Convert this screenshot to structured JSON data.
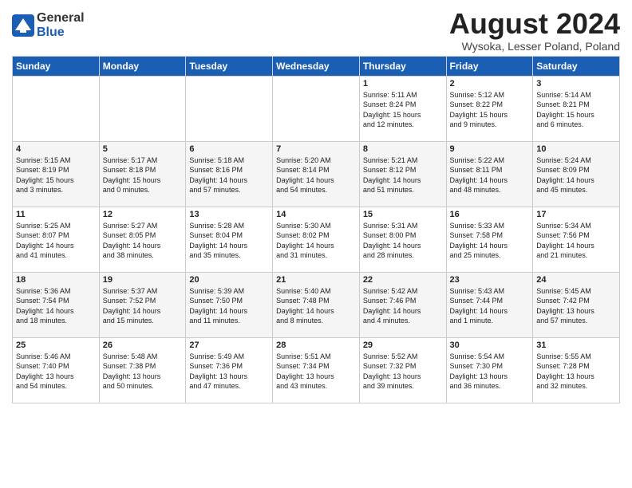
{
  "header": {
    "logo_general": "General",
    "logo_blue": "Blue",
    "title": "August 2024",
    "location": "Wysoka, Lesser Poland, Poland"
  },
  "days_of_week": [
    "Sunday",
    "Monday",
    "Tuesday",
    "Wednesday",
    "Thursday",
    "Friday",
    "Saturday"
  ],
  "weeks": [
    [
      {
        "day": "",
        "info": ""
      },
      {
        "day": "",
        "info": ""
      },
      {
        "day": "",
        "info": ""
      },
      {
        "day": "",
        "info": ""
      },
      {
        "day": "1",
        "info": "Sunrise: 5:11 AM\nSunset: 8:24 PM\nDaylight: 15 hours\nand 12 minutes."
      },
      {
        "day": "2",
        "info": "Sunrise: 5:12 AM\nSunset: 8:22 PM\nDaylight: 15 hours\nand 9 minutes."
      },
      {
        "day": "3",
        "info": "Sunrise: 5:14 AM\nSunset: 8:21 PM\nDaylight: 15 hours\nand 6 minutes."
      }
    ],
    [
      {
        "day": "4",
        "info": "Sunrise: 5:15 AM\nSunset: 8:19 PM\nDaylight: 15 hours\nand 3 minutes."
      },
      {
        "day": "5",
        "info": "Sunrise: 5:17 AM\nSunset: 8:18 PM\nDaylight: 15 hours\nand 0 minutes."
      },
      {
        "day": "6",
        "info": "Sunrise: 5:18 AM\nSunset: 8:16 PM\nDaylight: 14 hours\nand 57 minutes."
      },
      {
        "day": "7",
        "info": "Sunrise: 5:20 AM\nSunset: 8:14 PM\nDaylight: 14 hours\nand 54 minutes."
      },
      {
        "day": "8",
        "info": "Sunrise: 5:21 AM\nSunset: 8:12 PM\nDaylight: 14 hours\nand 51 minutes."
      },
      {
        "day": "9",
        "info": "Sunrise: 5:22 AM\nSunset: 8:11 PM\nDaylight: 14 hours\nand 48 minutes."
      },
      {
        "day": "10",
        "info": "Sunrise: 5:24 AM\nSunset: 8:09 PM\nDaylight: 14 hours\nand 45 minutes."
      }
    ],
    [
      {
        "day": "11",
        "info": "Sunrise: 5:25 AM\nSunset: 8:07 PM\nDaylight: 14 hours\nand 41 minutes."
      },
      {
        "day": "12",
        "info": "Sunrise: 5:27 AM\nSunset: 8:05 PM\nDaylight: 14 hours\nand 38 minutes."
      },
      {
        "day": "13",
        "info": "Sunrise: 5:28 AM\nSunset: 8:04 PM\nDaylight: 14 hours\nand 35 minutes."
      },
      {
        "day": "14",
        "info": "Sunrise: 5:30 AM\nSunset: 8:02 PM\nDaylight: 14 hours\nand 31 minutes."
      },
      {
        "day": "15",
        "info": "Sunrise: 5:31 AM\nSunset: 8:00 PM\nDaylight: 14 hours\nand 28 minutes."
      },
      {
        "day": "16",
        "info": "Sunrise: 5:33 AM\nSunset: 7:58 PM\nDaylight: 14 hours\nand 25 minutes."
      },
      {
        "day": "17",
        "info": "Sunrise: 5:34 AM\nSunset: 7:56 PM\nDaylight: 14 hours\nand 21 minutes."
      }
    ],
    [
      {
        "day": "18",
        "info": "Sunrise: 5:36 AM\nSunset: 7:54 PM\nDaylight: 14 hours\nand 18 minutes."
      },
      {
        "day": "19",
        "info": "Sunrise: 5:37 AM\nSunset: 7:52 PM\nDaylight: 14 hours\nand 15 minutes."
      },
      {
        "day": "20",
        "info": "Sunrise: 5:39 AM\nSunset: 7:50 PM\nDaylight: 14 hours\nand 11 minutes."
      },
      {
        "day": "21",
        "info": "Sunrise: 5:40 AM\nSunset: 7:48 PM\nDaylight: 14 hours\nand 8 minutes."
      },
      {
        "day": "22",
        "info": "Sunrise: 5:42 AM\nSunset: 7:46 PM\nDaylight: 14 hours\nand 4 minutes."
      },
      {
        "day": "23",
        "info": "Sunrise: 5:43 AM\nSunset: 7:44 PM\nDaylight: 14 hours\nand 1 minute."
      },
      {
        "day": "24",
        "info": "Sunrise: 5:45 AM\nSunset: 7:42 PM\nDaylight: 13 hours\nand 57 minutes."
      }
    ],
    [
      {
        "day": "25",
        "info": "Sunrise: 5:46 AM\nSunset: 7:40 PM\nDaylight: 13 hours\nand 54 minutes."
      },
      {
        "day": "26",
        "info": "Sunrise: 5:48 AM\nSunset: 7:38 PM\nDaylight: 13 hours\nand 50 minutes."
      },
      {
        "day": "27",
        "info": "Sunrise: 5:49 AM\nSunset: 7:36 PM\nDaylight: 13 hours\nand 47 minutes."
      },
      {
        "day": "28",
        "info": "Sunrise: 5:51 AM\nSunset: 7:34 PM\nDaylight: 13 hours\nand 43 minutes."
      },
      {
        "day": "29",
        "info": "Sunrise: 5:52 AM\nSunset: 7:32 PM\nDaylight: 13 hours\nand 39 minutes."
      },
      {
        "day": "30",
        "info": "Sunrise: 5:54 AM\nSunset: 7:30 PM\nDaylight: 13 hours\nand 36 minutes."
      },
      {
        "day": "31",
        "info": "Sunrise: 5:55 AM\nSunset: 7:28 PM\nDaylight: 13 hours\nand 32 minutes."
      }
    ]
  ]
}
